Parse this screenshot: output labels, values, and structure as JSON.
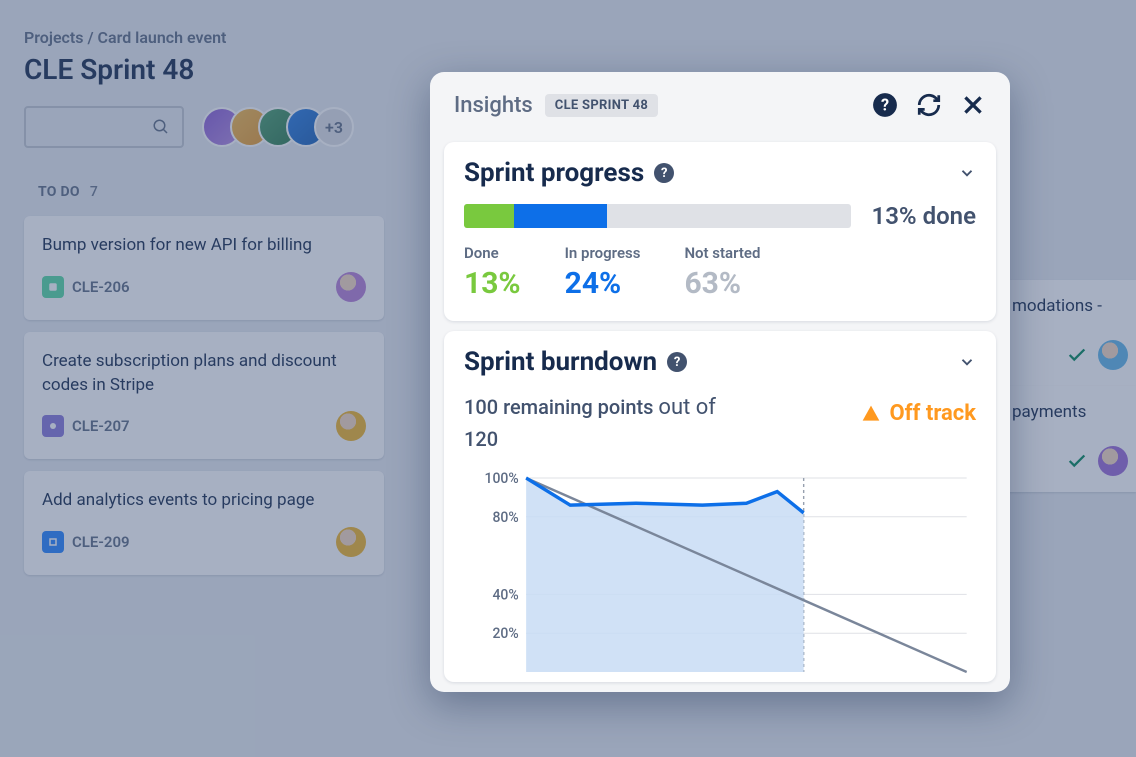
{
  "breadcrumb": "Projects / Card launch event",
  "page_title": "CLE Sprint 48",
  "avatar_overflow": "+3",
  "column": {
    "header": "TO DO",
    "count": "7"
  },
  "cards": [
    {
      "title": "Bump version for new API for billing",
      "key": "CLE-206",
      "icon": "green",
      "av": "#b77ed6"
    },
    {
      "title": "Create subscription plans and discount codes in Stripe",
      "key": "CLE-207",
      "icon": "purple",
      "av": "#f0b429"
    },
    {
      "title": "Add analytics events to pricing page",
      "key": "CLE-209",
      "icon": "blue",
      "av": "#f0b429"
    }
  ],
  "right_cards": [
    {
      "text": "modations -",
      "av": "#5fb5e8"
    },
    {
      "text": "payments",
      "av": "#9a6bd6"
    }
  ],
  "insights": {
    "title": "Insights",
    "pill": "CLE SPRINT 48",
    "progress": {
      "title": "Sprint progress",
      "done_summary": "13% done",
      "labels": {
        "done": "Done",
        "in_progress": "In progress",
        "not_started": "Not started"
      },
      "values": {
        "done": "13%",
        "in_progress": "24%",
        "not_started": "63%"
      },
      "bar": {
        "done": 13,
        "in_progress": 24
      }
    },
    "burndown": {
      "title": "Sprint burndown",
      "remaining_prefix": "100 remaining points",
      "out_of": "out of",
      "total": "120",
      "status": "Off track"
    }
  },
  "chart_data": {
    "type": "line",
    "title": "Sprint burndown",
    "ylabel": "",
    "xlabel": "",
    "ylim": [
      0,
      100
    ],
    "y_ticks": [
      "100%",
      "80%",
      "40%",
      "20%"
    ],
    "ideal": {
      "x": [
        0,
        10
      ],
      "y": [
        100,
        0
      ]
    },
    "actual": {
      "x": [
        0,
        1,
        2.5,
        4,
        5,
        5.7,
        6.3
      ],
      "y": [
        100,
        86,
        87,
        86,
        87,
        93,
        82
      ]
    },
    "today_marker_x": 6.3
  },
  "avatars": [
    {
      "bg": "#8a5cd6"
    },
    {
      "bg": "#f2b94d"
    },
    {
      "bg": "#4a9e6e"
    },
    {
      "bg": "#2a7de1"
    }
  ]
}
